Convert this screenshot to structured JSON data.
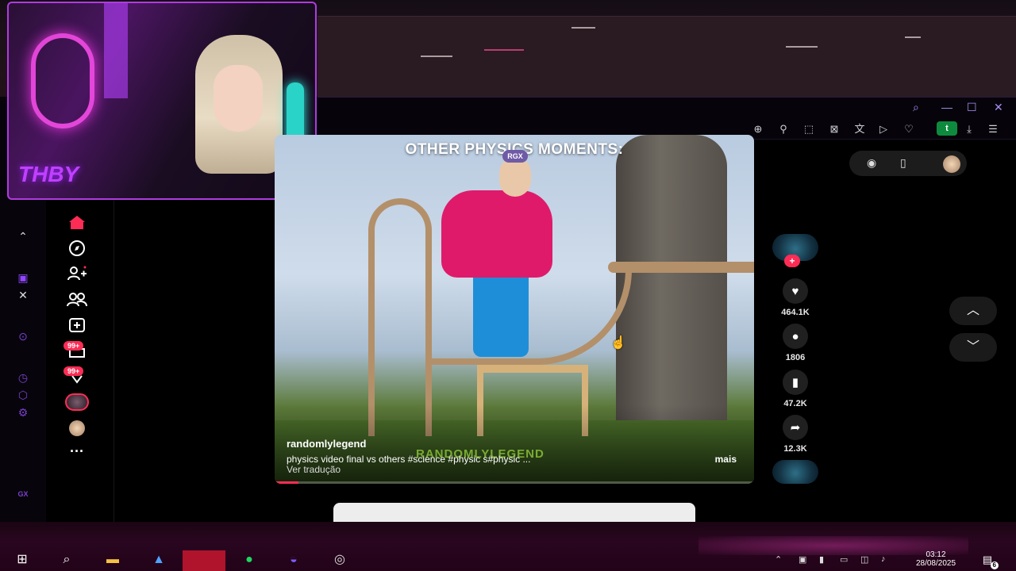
{
  "browser": {
    "window_controls": {
      "search": "⌕",
      "minimize": "—",
      "maximize": "☐",
      "close": "✕"
    },
    "toolbar_icons": [
      "zoom-in-icon",
      "pin-icon",
      "snapshot-icon",
      "adblock-icon",
      "translate-icon",
      "send-icon",
      "heart-icon"
    ],
    "profile_initial": "t",
    "accent_color": "#a98ff5"
  },
  "gx_sidebar": {
    "label": "GX",
    "icons": [
      "home-up-icon",
      "twitch-icon",
      "x-icon",
      "player-icon",
      "history-icon",
      "extensions-icon",
      "settings-icon"
    ]
  },
  "tiktok_nav": {
    "home_icon_color": "#fe2c55",
    "messages_badge": "99+",
    "activity_badge": "99+",
    "more": "···"
  },
  "webcam": {
    "logo_text": "THBY",
    "border_color": "#b03be0"
  },
  "video": {
    "overlay_title": "OTHER PHYSICS MOMENTS:",
    "overlay_badge": "RGX",
    "watermark": "RANDOMLYLEGEND",
    "author": "randomlylegend",
    "description": "physics video final vs others #science  #physic s#physic ...",
    "more_label": "mais",
    "translate_label": "Ver tradução",
    "progress_fraction": 0.05
  },
  "actions": {
    "follow_label": "+",
    "likes": "464.1K",
    "comments": "1806",
    "saves": "47.2K",
    "shares": "12.3K"
  },
  "top_pill": {
    "icons": [
      "eye-icon",
      "device-icon",
      "profile-avatar"
    ]
  },
  "navigation": {
    "up_label": "︿",
    "down_label": "﹀"
  },
  "taskbar": {
    "apps": [
      "windows-start-icon",
      "search-icon",
      "file-explorer-icon",
      "app-icon",
      "app-red-icon",
      "spotify-icon",
      "discord-icon",
      "obs-icon"
    ],
    "time": "03:12",
    "date": "28/08/2025",
    "notification_count": "6"
  }
}
